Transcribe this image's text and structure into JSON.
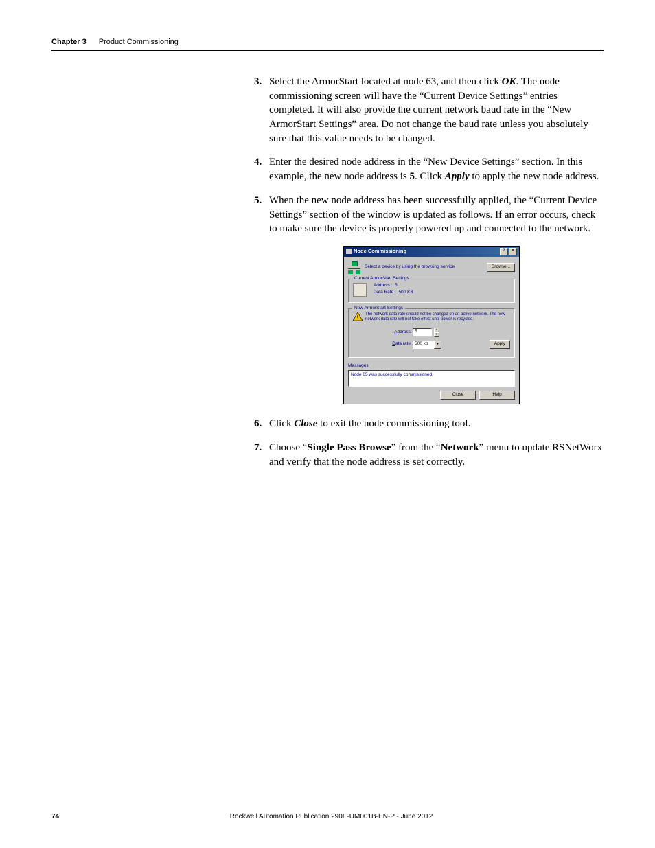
{
  "header": {
    "chapter": "Chapter 3",
    "title": "Product Commissioning"
  },
  "steps": {
    "s3_a": "Select the ArmorStart located at node 63, and then click ",
    "s3_ok": "OK",
    "s3_b": ". The node commissioning screen will have the “Current Device Settings” entries completed. It will also provide the current network baud rate in the “New ArmorStart Settings” area. Do not change the baud rate unless you absolutely sure that this value needs to be changed.",
    "s4_a": "Enter the desired node address in the “New Device Settings” section. In this example, the new node address is ",
    "s4_five": "5",
    "s4_b": ". Click ",
    "s4_apply": "Apply",
    "s4_c": " to apply the new node address.",
    "s5": "When the new node address has been successfully applied, the “Current Device Settings” section of the window is updated as follows. If an error occurs, check to make sure the device is properly powered up and connected to the network.",
    "s6_a": "Click ",
    "s6_close": "Close",
    "s6_b": " to exit the node commissioning tool.",
    "s7_a": "Choose “",
    "s7_spb": "Single Pass Browse",
    "s7_b": "” from the “",
    "s7_net": "Network",
    "s7_c": "” menu to update RSNetWorx and verify that the node address is set correctly."
  },
  "dialog": {
    "title": "Node Commissioning",
    "help_btn": "?",
    "close_btn": "×",
    "hint": "Select a device by using the browsing service",
    "browse": "Browse...",
    "current_legend": "Current ArmorStart Settings",
    "addr_label": "Address :",
    "addr_value": "5",
    "rate_label": "Data Rate :",
    "rate_value": "500 KB",
    "new_legend": "New ArmorStart Settings",
    "warning": "The network data rate should not be changed on an active network. The new network data rate will not take effect until power is recycled.",
    "f_address_lbl_u": "A",
    "f_address_lbl": "ddress",
    "f_address_val": "5",
    "f_rate_lbl_u": "D",
    "f_rate_lbl": "ata rate",
    "f_rate_val": "500 kb",
    "apply": "Apply",
    "messages_lbl": "Messages",
    "messages_val": "Node 05 was successfully commissioned.",
    "close": "Close",
    "help": "Help"
  },
  "footer": {
    "page": "74",
    "pub": "Rockwell Automation Publication 290E-UM001B-EN-P - June 2012"
  }
}
